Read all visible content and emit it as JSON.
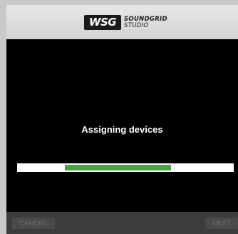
{
  "header": {
    "logo_badge": "WSG",
    "logo_line1": "SOUNDGRID",
    "logo_line2": "STUDIO"
  },
  "main": {
    "status_text": "Assigning devices",
    "progress": {
      "start_fraction": 0.22,
      "end_fraction": 0.71,
      "fill_color": "#4ca247",
      "track_color": "#ffffff"
    }
  },
  "footer": {
    "cancel_label": "CANCEL",
    "next_label": "NEXT"
  }
}
